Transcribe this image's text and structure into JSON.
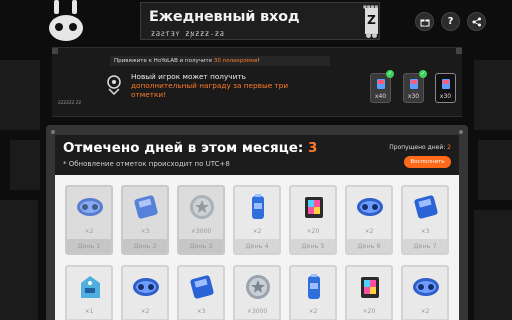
{
  "header": {
    "title": "Ежедневный вход",
    "subtitle": "ƵƋƧƬƎƳ ƵƝƵƵƵ-ƵƋ",
    "mark": "Z"
  },
  "toolbar": {
    "gift_icon": "gift-icon",
    "help_label": "?",
    "share_icon": "share-icon"
  },
  "banner": {
    "promo_prefix": "Привяжите к HoYoLAB и получите ",
    "promo_highlight": "30 полихромов",
    "promo_suffix": "!",
    "newbie_line1": "Новый игрок может получить",
    "newbie_highlight": "дополнительный награду за первые три отметки!",
    "rewards": [
      {
        "count": "x40",
        "claimed": true
      },
      {
        "count": "x30",
        "claimed": true
      },
      {
        "count": "x30",
        "claimed": false
      }
    ]
  },
  "panel": {
    "title_prefix": "Отмечено дней в этом месяце: ",
    "checked_days": "3",
    "utc_note": "* Обновление отметок происходит по UTC+8",
    "missed_prefix": "Пропущено дней: ",
    "missed_days": "2",
    "restore_button": "Восполнить"
  },
  "days": [
    {
      "label": "День 1",
      "qty": "×2",
      "item": "goggles",
      "state": "claimed"
    },
    {
      "label": "День 2",
      "qty": "×3",
      "item": "disk",
      "state": "claimed"
    },
    {
      "label": "День 3",
      "qty": "×3000",
      "item": "coin",
      "state": "claimed"
    },
    {
      "label": "День 4",
      "qty": "×2",
      "item": "battery",
      "state": "open"
    },
    {
      "label": "День 5",
      "qty": "×20",
      "item": "film",
      "state": "open"
    },
    {
      "label": "День 6",
      "qty": "×2",
      "item": "goggles",
      "state": "open"
    },
    {
      "label": "День 7",
      "qty": "×3",
      "item": "disk",
      "state": "open"
    },
    {
      "label": "",
      "qty": "×1",
      "item": "tag",
      "state": "open"
    },
    {
      "label": "",
      "qty": "×2",
      "item": "goggles",
      "state": "open"
    },
    {
      "label": "",
      "qty": "×3",
      "item": "disk",
      "state": "open"
    },
    {
      "label": "",
      "qty": "×3000",
      "item": "coin",
      "state": "open"
    },
    {
      "label": "",
      "qty": "×2",
      "item": "battery",
      "state": "open"
    },
    {
      "label": "",
      "qty": "×20",
      "item": "film",
      "state": "open"
    },
    {
      "label": "",
      "qty": "×2",
      "item": "goggles",
      "state": "open"
    }
  ],
  "colors": {
    "accent": "#ff7a2a",
    "claimed_check": "#3cd15a"
  }
}
